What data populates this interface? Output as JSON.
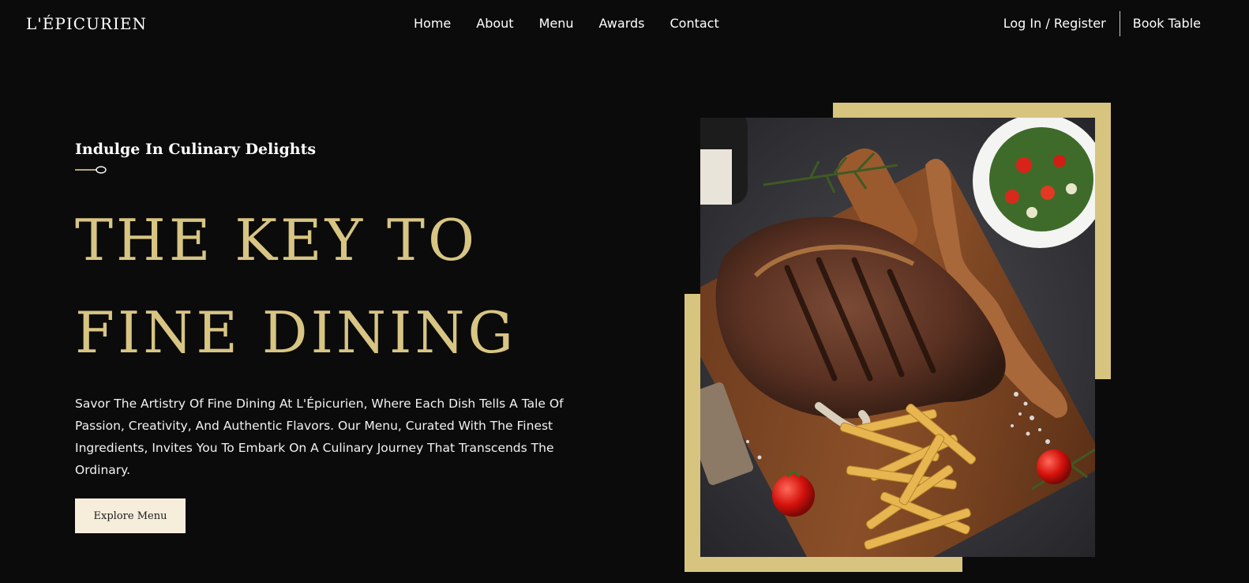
{
  "brand": {
    "logo": "L'ÉPICURIEN"
  },
  "nav": {
    "items": [
      "Home",
      "About",
      "Menu",
      "Awards",
      "Contact"
    ]
  },
  "header_actions": {
    "login": "Log In / Register",
    "book": "Book Table"
  },
  "hero": {
    "eyebrow": "Indulge In Culinary Delights",
    "headline_line1": "THE KEY TO",
    "headline_line2": "FINE DINING",
    "description": "Savor The Artistry Of Fine Dining At L'Épicurien, Where Each Dish Tells A Tale Of Passion, Creativity, And Authentic Flavors. Our Menu, Curated With The Finest Ingredients, Invites You To Embark On A Culinary Journey That Transcends The Ordinary.",
    "cta": "Explore Menu"
  },
  "colors": {
    "background": "#0b0b0b",
    "accent_gold": "#d8c583",
    "button_bg": "#f6eedb"
  }
}
